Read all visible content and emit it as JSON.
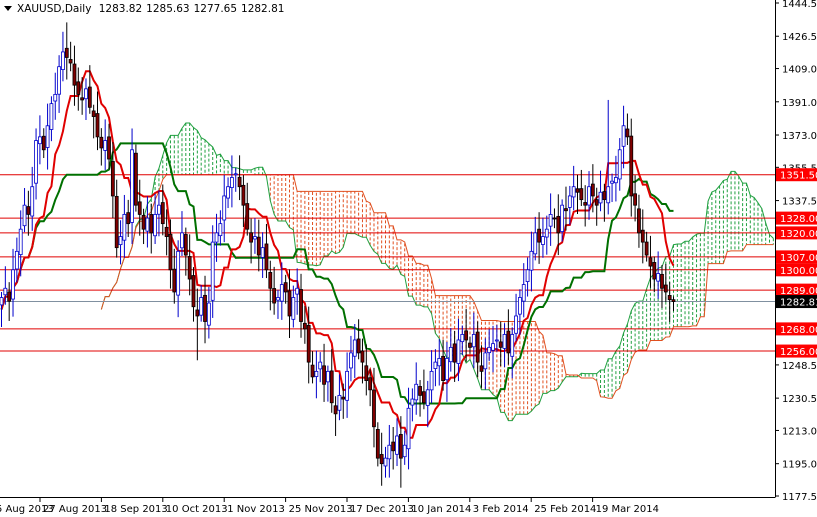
{
  "header": {
    "symbol": "XAUUSD,Daily",
    "open": "1283.82",
    "high": "1285.63",
    "low": "1277.65",
    "close": "1282.81"
  },
  "chart_data": {
    "type": "candlestick",
    "title": "XAUUSD,Daily",
    "indicator": "Ichimoku Kinko Hyo (9,26,52)",
    "ylim": [
      1177.5,
      1444.5
    ],
    "price_ticks": [
      "1444.50",
      "1426.50",
      "1409.00",
      "1391.00",
      "1373.00",
      "1355.50",
      "1337.50",
      "1248.50",
      "1230.50",
      "1213.00",
      "1195.00",
      "1177.50"
    ],
    "date_labels": [
      "5 Aug 2013",
      "27 Aug 2013",
      "18 Sep 2013",
      "10 Oct 2013",
      "1 Nov 2013",
      "25 Nov 2013",
      "17 Dec 2013",
      "10 Jan 2014",
      "3 Feb 2014",
      "25 Feb 2014",
      "19 Mar 2014"
    ],
    "levels": [
      "1351.50",
      "1328.00",
      "1320.00",
      "1307.00",
      "1300.00",
      "1289.00",
      "1268.00",
      "1256.00"
    ],
    "current_price": "1282.81",
    "last_bar": {
      "open": 1283.82,
      "high": 1285.63,
      "low": 1277.65,
      "close": 1282.81
    },
    "closes": [
      1285,
      1290,
      1283,
      1300,
      1310,
      1322,
      1335,
      1330,
      1345,
      1370,
      1372,
      1365,
      1378,
      1390,
      1395,
      1410,
      1418,
      1415,
      1412,
      1400,
      1395,
      1392,
      1398,
      1388,
      1383,
      1372,
      1366,
      1370,
      1360,
      1340,
      1312,
      1318,
      1330,
      1325,
      1365,
      1335,
      1330,
      1322,
      1328,
      1320,
      1330,
      1335,
      1325,
      1318,
      1300,
      1288,
      1310,
      1320,
      1308,
      1295,
      1280,
      1275,
      1285,
      1272,
      1282,
      1315,
      1320,
      1325,
      1340,
      1345,
      1350,
      1352,
      1345,
      1335,
      1322,
      1315,
      1318,
      1308,
      1312,
      1300,
      1290,
      1282,
      1285,
      1292,
      1288,
      1275,
      1285,
      1290,
      1272,
      1268,
      1250,
      1242,
      1245,
      1250,
      1238,
      1245,
      1228,
      1222,
      1232,
      1230,
      1245,
      1255,
      1262,
      1255,
      1250,
      1240,
      1235,
      1215,
      1198,
      1195,
      1198,
      1205,
      1202,
      1210,
      1198,
      1205,
      1225,
      1230,
      1238,
      1232,
      1228,
      1235,
      1245,
      1250,
      1252,
      1240,
      1252,
      1258,
      1250,
      1262,
      1265,
      1262,
      1258,
      1265,
      1250,
      1245,
      1255,
      1258,
      1260,
      1262,
      1258,
      1265,
      1255,
      1265,
      1275,
      1285,
      1292,
      1300,
      1310,
      1320,
      1315,
      1318,
      1322,
      1330,
      1328,
      1320,
      1335,
      1332,
      1340,
      1345,
      1342,
      1338,
      1335,
      1345,
      1340,
      1335,
      1342,
      1338,
      1345,
      1348,
      1350,
      1365,
      1378,
      1372,
      1340,
      1335,
      1320,
      1315,
      1308,
      1302,
      1295,
      1298,
      1290,
      1288,
      1283.82,
      1282.81
    ],
    "colors": {
      "bull": "#0000cc",
      "bear": "#800000",
      "tenkan": "#e00000",
      "kijun": "#007000",
      "level": "#e00000",
      "cloud_bear": "#e05020",
      "cloud_bull": "#20a040"
    }
  }
}
